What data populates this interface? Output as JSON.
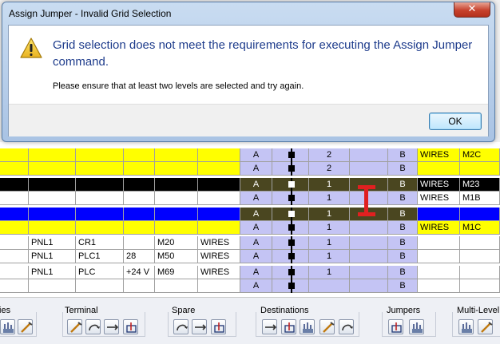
{
  "dialog": {
    "title": "Assign Jumper - Invalid Grid Selection",
    "close_label": "✕",
    "main_message": "Grid selection does not meet the requirements for executing the Assign Jumper command.",
    "sub_message": "Please ensure that at least two levels are selected and try again.",
    "ok_label": "OK"
  },
  "grid": {
    "rows": [
      {
        "row_color": "yellow",
        "c1": "",
        "c2": "",
        "c3": "",
        "c4": "",
        "c5": "",
        "level_a": "A",
        "marker": "black",
        "num": "2",
        "level_b": "B",
        "wire": "WIRES",
        "tag": "M2C"
      },
      {
        "row_color": "yellow",
        "c1": "",
        "c2": "",
        "c3": "",
        "c4": "",
        "c5": "",
        "level_a": "A",
        "marker": "black",
        "num": "2",
        "level_b": "B",
        "wire": "",
        "tag": ""
      },
      {
        "row_color": "black",
        "c1": "",
        "c2": "",
        "c3": "",
        "c4": "",
        "c5": "",
        "level_a": "A",
        "marker": "white",
        "num": "1",
        "level_b": "B",
        "wire": "WIRES",
        "tag": "M23"
      },
      {
        "row_color": "white",
        "c1": "",
        "c2": "",
        "c3": "",
        "c4": "",
        "c5": "",
        "level_a": "A",
        "marker": "black",
        "num": "1",
        "level_b": "B",
        "wire": "WIRES",
        "tag": "M1B"
      },
      {
        "row_color": "blue",
        "c1": "",
        "c2": "",
        "c3": "",
        "c4": "",
        "c5": "",
        "level_a": "A",
        "marker": "white",
        "num": "1",
        "level_b": "B",
        "wire": "",
        "tag": ""
      },
      {
        "row_color": "yellow",
        "c1": "",
        "c2": "",
        "c3": "",
        "c4": "",
        "c5": "",
        "level_a": "A",
        "marker": "black",
        "num": "1",
        "level_b": "B",
        "wire": "WIRES",
        "tag": "M1C"
      },
      {
        "row_color": "white",
        "c1": "PNL1",
        "c2": "CR1",
        "c3": "",
        "c4": "M20",
        "c5": "WIRES",
        "level_a": "A",
        "marker": "black",
        "num": "1",
        "level_b": "B",
        "wire": "",
        "tag": ""
      },
      {
        "row_color": "white",
        "c1": "PNL1",
        "c2": "PLC1",
        "c3": "28",
        "c4": "M50",
        "c5": "WIRES",
        "level_a": "A",
        "marker": "black",
        "num": "1",
        "level_b": "B",
        "wire": "",
        "tag": ""
      },
      {
        "row_color": "white",
        "c1": "PNL1",
        "c2": "PLC",
        "c3": "+24 V",
        "c4": "M69",
        "c5": "WIRES",
        "level_a": "A",
        "marker": "black",
        "num": "1",
        "level_b": "B",
        "wire": "",
        "tag": ""
      },
      {
        "row_color": "white",
        "c1": "",
        "c2": "",
        "c3": "",
        "c4": "",
        "c5": "",
        "level_a": "A",
        "marker": "black",
        "num": "",
        "level_b": "B",
        "wire": "",
        "tag": ""
      }
    ]
  },
  "ribbon": {
    "groups": [
      {
        "label": "ties",
        "icons": [
          "properties-icon",
          "properties-alt-icon"
        ]
      },
      {
        "label": "Terminal",
        "icons": [
          "edit-terminal-icon",
          "rotate-terminal-icon",
          "move-terminal-icon",
          "swap-terminal-icon"
        ]
      },
      {
        "label": "Spare",
        "icons": [
          "spare-insert-icon",
          "spare-delete-icon",
          "spare-toggle-icon"
        ]
      },
      {
        "label": "Destinations",
        "icons": [
          "dest-insert-icon",
          "dest-move-up-icon",
          "dest-move-down-icon",
          "dest-reverse-icon",
          "dest-delete-icon"
        ]
      },
      {
        "label": "Jumpers",
        "icons": [
          "assign-jumper-icon",
          "edit-jumper-icon"
        ]
      },
      {
        "label": "Multi-Level",
        "icons": [
          "multi-level-add-icon",
          "multi-level-remove-icon"
        ]
      }
    ]
  },
  "colors": {
    "yellow": "#ffff00",
    "blue": "#0000ff",
    "black": "#000000",
    "selection": "#c4c4f4",
    "selected_row": "#4a4620",
    "jumper": "#e02020"
  }
}
